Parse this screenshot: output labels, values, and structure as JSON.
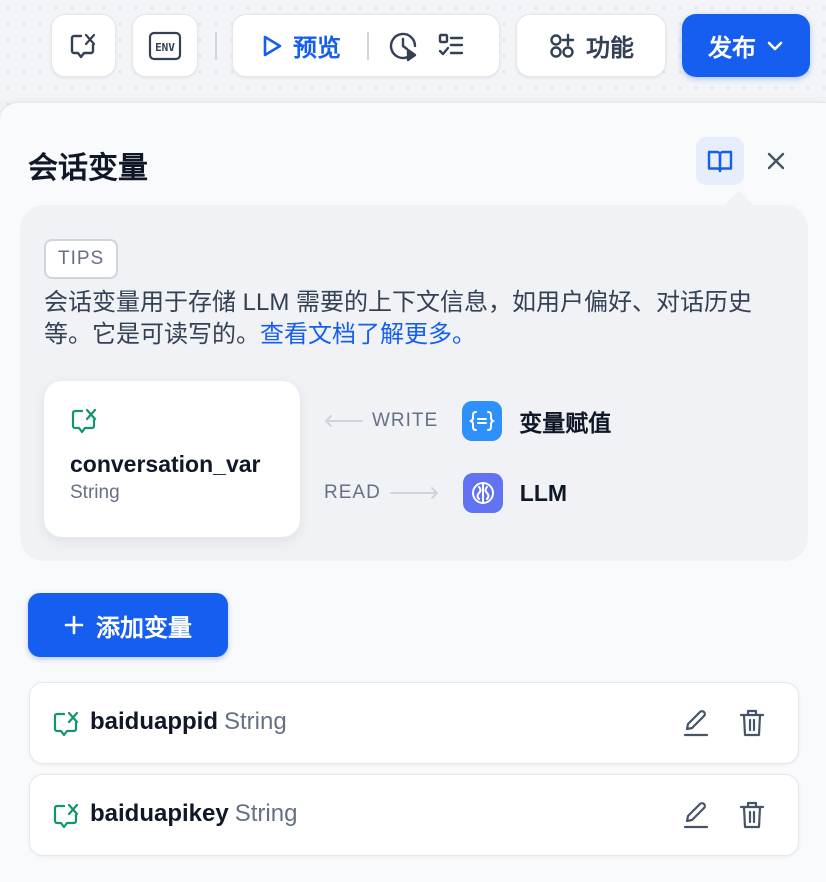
{
  "toolbar": {
    "conversation_vars_icon": "conversation-variable-icon",
    "env_label": "ENV",
    "preview_label": "预览",
    "features_label": "功能",
    "publish_label": "发布"
  },
  "panel": {
    "title": "会话变量",
    "tips": {
      "badge": "TIPS",
      "text": "会话变量用于存储 LLM 需要的上下文信息，如用户偏好、对话历史等。它是可读写的。",
      "link_text": "查看文档了解更多。"
    },
    "example": {
      "var_name": "conversation_var",
      "var_type": "String",
      "write_label": "WRITE",
      "read_label": "READ",
      "write_target": "变量赋值",
      "read_target": "LLM"
    },
    "add_button_label": "添加变量",
    "variables": [
      {
        "name": "baiduappid",
        "type": "String"
      },
      {
        "name": "baiduapikey",
        "type": "String"
      }
    ]
  },
  "colors": {
    "accent": "#155eef",
    "var_icon": "#12946f",
    "assign_icon_bg": "#2e90fa",
    "llm_icon_bg": "#6172f3"
  }
}
